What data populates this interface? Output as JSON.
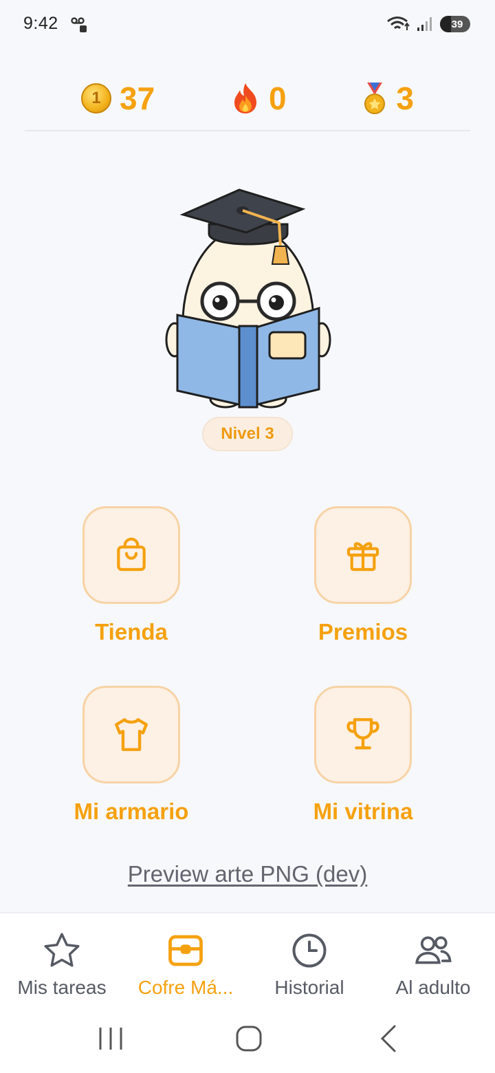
{
  "status_bar": {
    "time": "9:42",
    "battery": "39"
  },
  "stats": {
    "coins": {
      "value": "37",
      "icon": "coin-icon",
      "coin_glyph": "1"
    },
    "streak": {
      "value": "0",
      "icon": "fire-icon"
    },
    "medals": {
      "value": "3",
      "icon": "medal-icon"
    }
  },
  "mascot": {
    "icon": "graduate-egg-reading-icon"
  },
  "level": {
    "label": "Nivel 3"
  },
  "tiles": [
    {
      "label": "Tienda",
      "icon": "shopping-bag-icon"
    },
    {
      "label": "Premios",
      "icon": "gift-icon"
    },
    {
      "label": "Mi armario",
      "icon": "tshirt-icon"
    },
    {
      "label": "Mi vitrina",
      "icon": "trophy-icon"
    }
  ],
  "preview_link": "Preview arte PNG (dev)",
  "bottom_nav": [
    {
      "label": "Mis tareas",
      "icon": "star-icon",
      "active": false
    },
    {
      "label": "Cofre Má...",
      "icon": "chest-icon",
      "active": true
    },
    {
      "label": "Historial",
      "icon": "clock-icon",
      "active": false
    },
    {
      "label": "Al adulto",
      "icon": "users-icon",
      "active": false
    }
  ],
  "colors": {
    "accent": "#f5a10f",
    "tile_bg": "#fdf0e4",
    "tile_border": "#f7d3a5",
    "muted": "#565a63",
    "book": "#8fb8e6"
  }
}
